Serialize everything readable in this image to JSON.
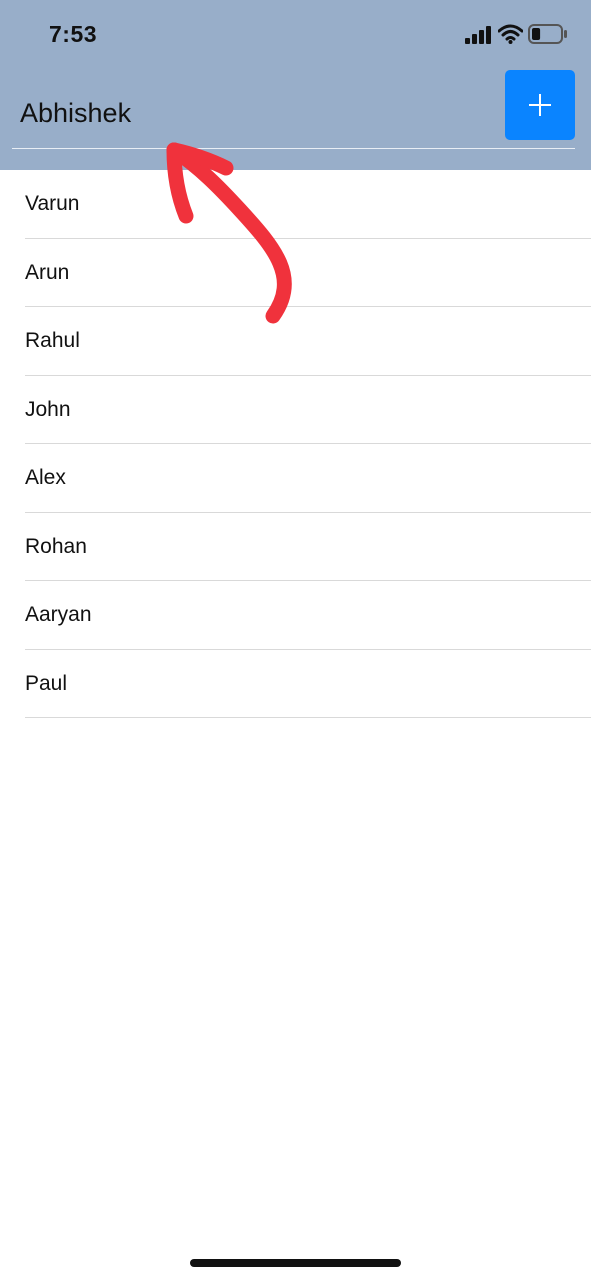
{
  "status_bar": {
    "time": "7:53",
    "signal_icon": "cellular-signal-icon",
    "wifi_icon": "wifi-icon",
    "battery_icon": "battery-icon",
    "battery_level": 0.3
  },
  "header": {
    "background": "#98aec9",
    "name_input": {
      "value": "Abhishek",
      "placeholder": ""
    },
    "add_button": {
      "icon": "plus-icon",
      "color": "#0a84ff"
    }
  },
  "list": {
    "items": [
      {
        "label": "Varun"
      },
      {
        "label": "Arun"
      },
      {
        "label": "Rahul"
      },
      {
        "label": "John"
      },
      {
        "label": "Alex"
      },
      {
        "label": "Rohan"
      },
      {
        "label": "Aaryan"
      },
      {
        "label": "Paul"
      }
    ]
  },
  "annotation": {
    "icon": "arrow-annotation-icon",
    "color": "#f0323c"
  }
}
